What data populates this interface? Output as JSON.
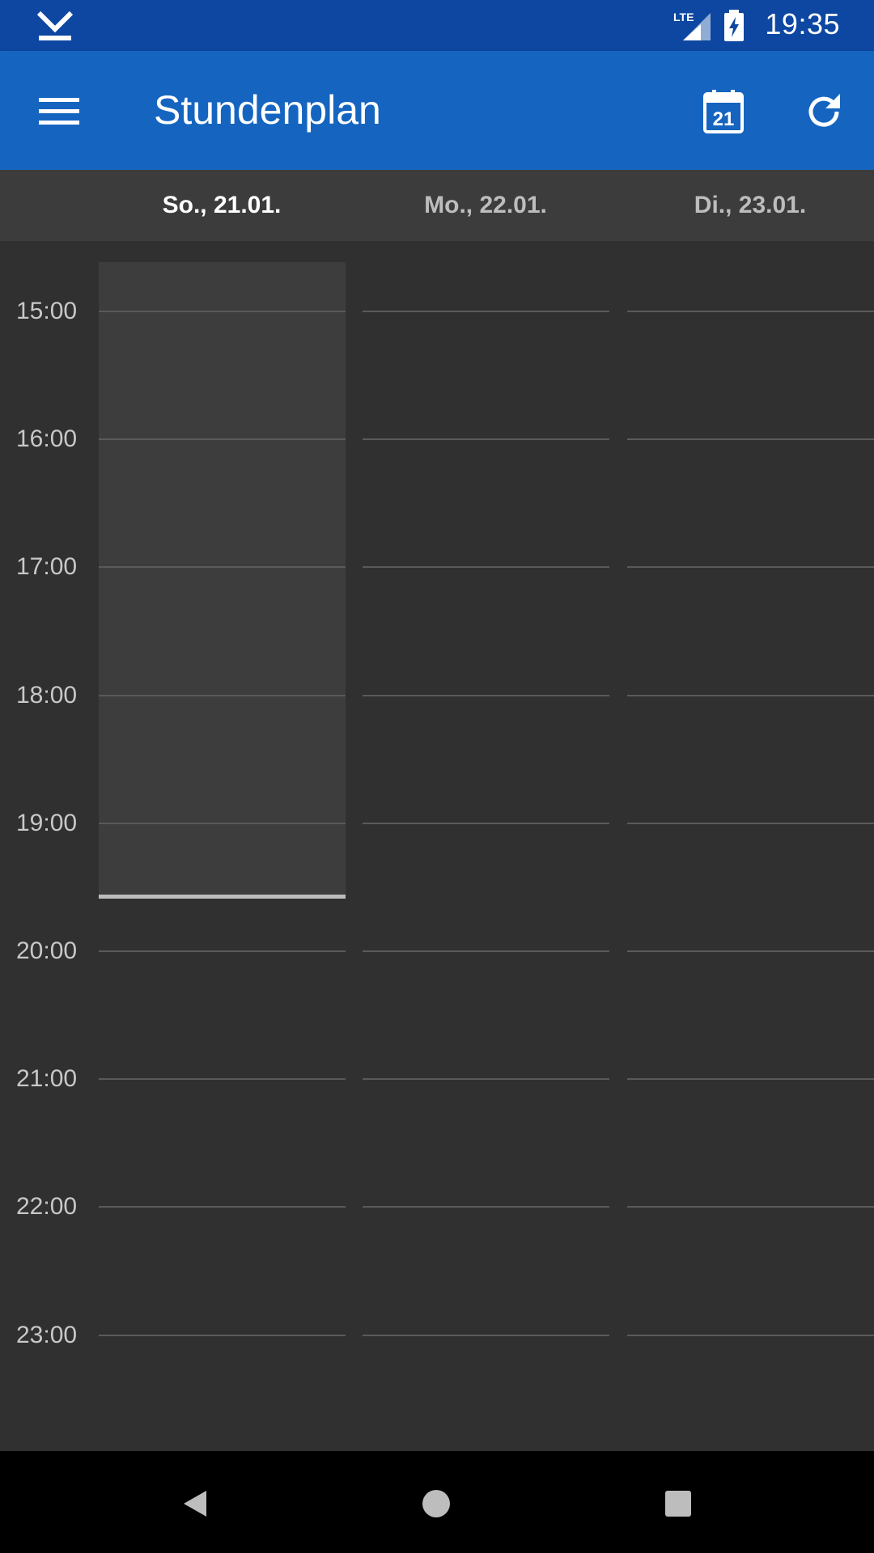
{
  "status_bar": {
    "network": "LTE",
    "time": "19:35",
    "left_icon": "download-complete-icon",
    "battery_icon": "battery-charging-icon",
    "signal_icon": "signal-icon"
  },
  "app_bar": {
    "title": "Stundenplan",
    "menu_icon": "menu-icon",
    "calendar_icon": "calendar-icon",
    "calendar_day": "21",
    "refresh_icon": "refresh-icon",
    "color": "#1565C0"
  },
  "day_header": {
    "days": [
      {
        "label": "So., 21.01.",
        "active": true
      },
      {
        "label": "Mo., 22.01.",
        "active": false
      },
      {
        "label": "Di., 23.01.",
        "active": false
      }
    ]
  },
  "timetable": {
    "hours": [
      "15:00",
      "16:00",
      "17:00",
      "18:00",
      "19:00",
      "20:00",
      "21:00",
      "22:00",
      "23:00"
    ],
    "now": "19:35"
  },
  "nav_bar": {
    "back_icon": "back-icon",
    "home_icon": "home-icon",
    "recents_icon": "recents-icon"
  }
}
